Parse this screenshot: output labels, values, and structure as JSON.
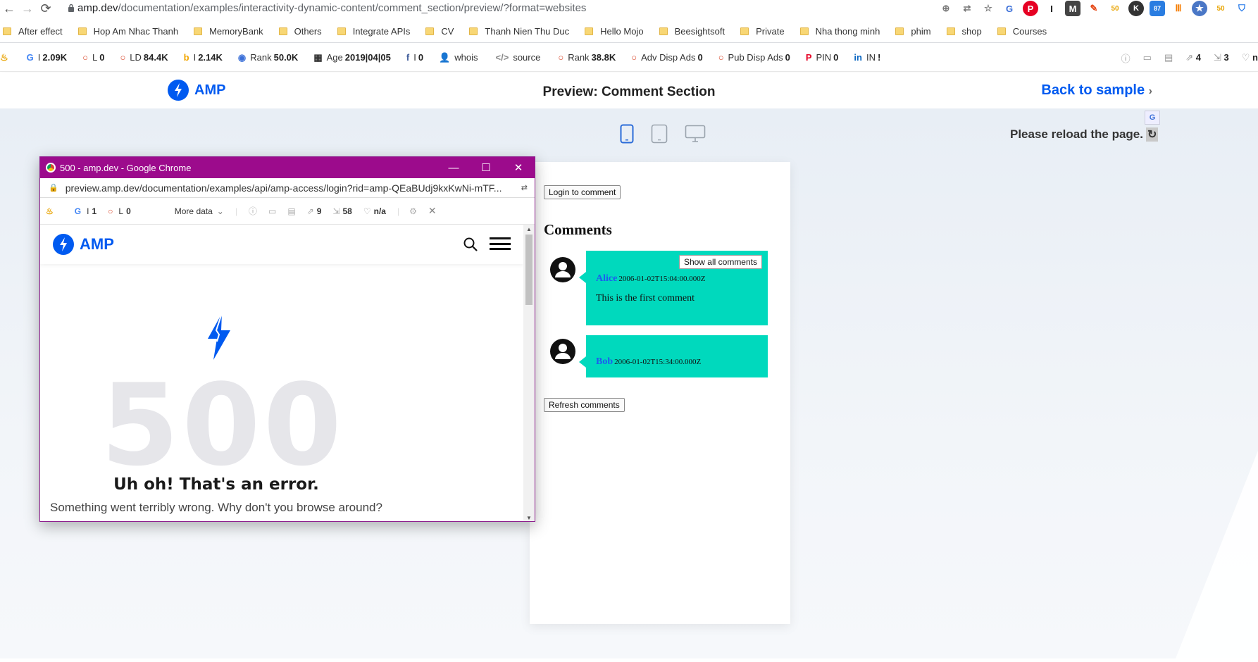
{
  "browser": {
    "url_host": "amp.dev",
    "url_path": "/documentation/examples/interactivity-dynamic-content/comment_section/preview/?format=websites",
    "ext_badge": "87"
  },
  "bookmarks": [
    "After effect",
    "Hop Am Nhac Thanh",
    "MemoryBank",
    "Others",
    "Integrate APIs",
    "CV",
    "Thanh Nien Thu Duc",
    "Hello Mojo",
    "Beesightsoft",
    "Private",
    "Nha thong minh",
    "phim",
    "shop",
    "Courses"
  ],
  "seo": [
    {
      "icon": "G",
      "label": "I",
      "value": "2.09K"
    },
    {
      "icon": "○",
      "label": "L",
      "value": "0"
    },
    {
      "icon": "○",
      "label": "LD",
      "value": "84.4K"
    },
    {
      "icon": "b",
      "label": "I",
      "value": "2.14K"
    },
    {
      "icon": "◉",
      "label": "Rank",
      "value": "50.0K"
    },
    {
      "icon": "▦",
      "label": "Age",
      "value": "2019|04|05"
    },
    {
      "icon": "f",
      "label": "I",
      "value": "0"
    },
    {
      "icon": "👤",
      "label": "whois",
      "value": ""
    },
    {
      "icon": "</>",
      "label": "source",
      "value": ""
    },
    {
      "icon": "○",
      "label": "Rank",
      "value": "38.8K"
    },
    {
      "icon": "○",
      "label": "Adv Disp Ads",
      "value": "0"
    },
    {
      "icon": "○",
      "label": "Pub Disp Ads",
      "value": "0"
    },
    {
      "icon": "P",
      "label": "PIN",
      "value": "0"
    },
    {
      "icon": "in",
      "label": "IN",
      "value": "!"
    }
  ],
  "seo_right": {
    "links_a": "4",
    "links_b": "3",
    "tail": "n"
  },
  "amp_header": {
    "logo": "AMP",
    "title": "Preview: Comment Section",
    "back": "Back to sample"
  },
  "reload": {
    "text": "Please reload the page.",
    "icon": "↻"
  },
  "preview": {
    "login_button": "Login to comment",
    "heading": "Comments",
    "show_all": "Show all comments",
    "comments": [
      {
        "author": "Alice",
        "date": "2006-01-02T15:04:00.000Z",
        "text": "This is the first comment"
      },
      {
        "author": "Bob",
        "date": "2006-01-02T15:34:00.000Z",
        "text": ""
      }
    ],
    "refresh_button": "Refresh comments"
  },
  "popup": {
    "title": "500 - amp.dev - Google Chrome",
    "url": "preview.amp.dev/documentation/examples/api/amp-access/login?rid=amp-QEaBUdj9kxKwNi-mTF...",
    "seo": {
      "g_label": "I",
      "g_value": "1",
      "l_label": "L",
      "l_value": "0",
      "more": "More data",
      "links": "9",
      "pages": "58",
      "na": "n/a"
    },
    "logo": "AMP",
    "error_code": "500",
    "error_title": "Uh oh! That's an error.",
    "error_sub": "Something went terribly wrong. Why don't you browse around?"
  }
}
